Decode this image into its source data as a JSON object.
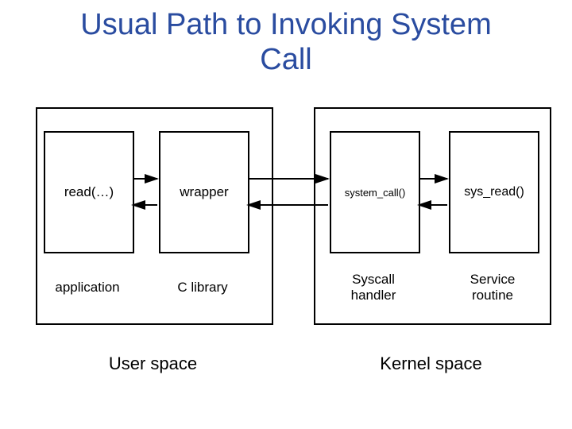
{
  "title_line1": "Usual Path to Invoking System",
  "title_line2": "Call",
  "boxes": {
    "read": "read(…)",
    "wrapper": "wrapper",
    "system_call": "system_call()",
    "sys_read": "sys_read()"
  },
  "labels": {
    "application": "application",
    "c_library": "C library",
    "syscall_handler_l1": "Syscall",
    "syscall_handler_l2": "handler",
    "service_routine_l1": "Service",
    "service_routine_l2": "routine",
    "user_space": "User space",
    "kernel_space": "Kernel space"
  }
}
